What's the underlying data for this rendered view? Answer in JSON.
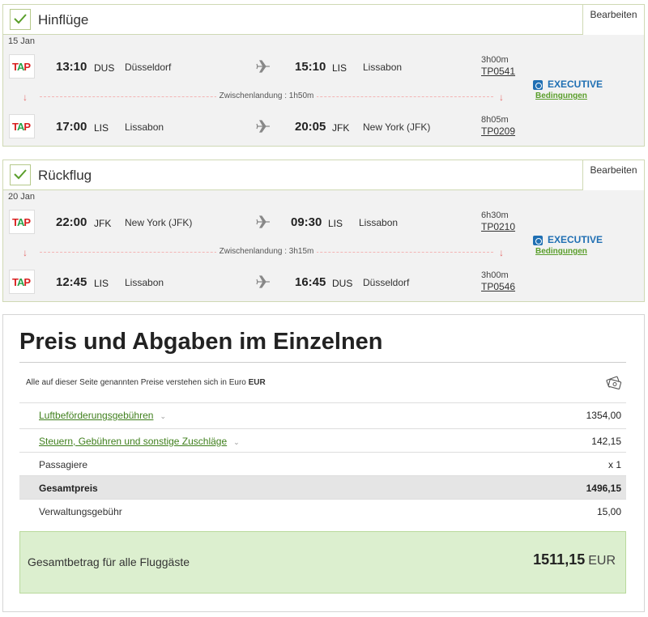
{
  "legs": [
    {
      "title": "Hinflüge",
      "edit_label": "Bearbeiten",
      "date": "15 Jan",
      "segments": [
        {
          "airline_logo": "TAP",
          "dep_time": "13:10",
          "dep_code": "DUS",
          "dep_city": "Düsseldorf",
          "arr_time": "15:10",
          "arr_code": "LIS",
          "arr_city": "Lissabon",
          "duration": "3h00m",
          "flight": "TP0541"
        },
        {
          "airline_logo": "TAP",
          "dep_time": "17:00",
          "dep_code": "LIS",
          "dep_city": "Lissabon",
          "arr_time": "20:05",
          "arr_code": "JFK",
          "arr_city": "New York (JFK)",
          "duration": "8h05m",
          "flight": "TP0209"
        }
      ],
      "stopover": "Zwischenlandung : 1h50m",
      "cabin": "EXECUTIVE",
      "conditions": "Bedingungen"
    },
    {
      "title": "Rückflug",
      "edit_label": "Bearbeiten",
      "date": "20 Jan",
      "segments": [
        {
          "airline_logo": "TAP",
          "dep_time": "22:00",
          "dep_code": "JFK",
          "dep_city": "New York (JFK)",
          "arr_time": "09:30",
          "arr_code": "LIS",
          "arr_city": "Lissabon",
          "duration": "6h30m",
          "flight": "TP0210"
        },
        {
          "airline_logo": "TAP",
          "dep_time": "12:45",
          "dep_code": "LIS",
          "dep_city": "Lissabon",
          "arr_time": "16:45",
          "arr_code": "DUS",
          "arr_city": "Düsseldorf",
          "duration": "3h00m",
          "flight": "TP0546"
        }
      ],
      "stopover": "Zwischenlandung : 3h15m",
      "cabin": "EXECUTIVE",
      "conditions": "Bedingungen"
    }
  ],
  "price": {
    "title": "Preis und Abgaben im Einzelnen",
    "currency_note": "Alle auf dieser Seite genannten Preise verstehen sich in Euro",
    "currency_code": "EUR",
    "rows": [
      {
        "label": "Luftbeförderungsgebühren",
        "value": "1354,00"
      },
      {
        "label": "Steuern, Gebühren und sonstige Zuschläge",
        "value": "142,15"
      },
      {
        "label": "Passagiere",
        "value": "x 1"
      },
      {
        "label": "Gesamtpreis",
        "value": "1496,15"
      },
      {
        "label": "Verwaltungsgebühr",
        "value": "15,00"
      }
    ],
    "grand_label": "Gesamtbetrag für alle Fluggäste",
    "grand_value": "1511,15",
    "grand_currency": "EUR"
  },
  "colors": {
    "accent_green": "#5a9e2b",
    "executive_blue": "#1f6fb3",
    "tap_red": "#d81e1e"
  }
}
